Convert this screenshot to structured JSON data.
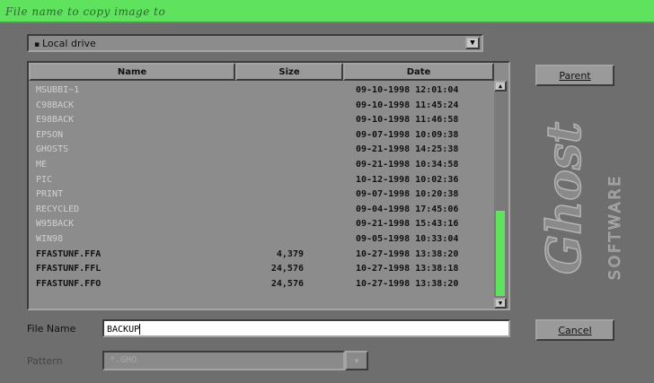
{
  "title": "File name to copy image to",
  "drive": {
    "label": "Local drive",
    "dropdown_icon": "triangle-down-icon"
  },
  "columns": [
    "Name",
    "Size",
    "Date"
  ],
  "files": [
    {
      "name": "MSUBBI~1",
      "size": "",
      "date": "09-10-1998 12:01:04",
      "kind": "dir"
    },
    {
      "name": "C98BACK",
      "size": "",
      "date": "09-10-1998 11:45:24",
      "kind": "dir"
    },
    {
      "name": "E98BACK",
      "size": "",
      "date": "09-10-1998 11:46:58",
      "kind": "dir"
    },
    {
      "name": "EPSON",
      "size": "",
      "date": "09-07-1998 10:09:38",
      "kind": "dir"
    },
    {
      "name": "GHOSTS",
      "size": "",
      "date": "09-21-1998 14:25:38",
      "kind": "dir"
    },
    {
      "name": "ME",
      "size": "",
      "date": "09-21-1998 10:34:58",
      "kind": "dir"
    },
    {
      "name": "PIC",
      "size": "",
      "date": "10-12-1998 10:02:36",
      "kind": "dir"
    },
    {
      "name": "PRINT",
      "size": "",
      "date": "09-07-1998 10:20:38",
      "kind": "dir"
    },
    {
      "name": "RECYCLED",
      "size": "",
      "date": "09-04-1998 17:45:06",
      "kind": "dir"
    },
    {
      "name": "W95BACK",
      "size": "",
      "date": "09-21-1998 15:43:16",
      "kind": "dir"
    },
    {
      "name": "WIN98",
      "size": "",
      "date": "09-05-1998 10:33:04",
      "kind": "dir"
    },
    {
      "name": "FFASTUNF.FFA",
      "size": "4,379",
      "date": "10-27-1998 13:38:20",
      "kind": "file"
    },
    {
      "name": "FFASTUNF.FFL",
      "size": "24,576",
      "date": "10-27-1998 13:38:18",
      "kind": "file"
    },
    {
      "name": "FFASTUNF.FFO",
      "size": "24,576",
      "date": "10-27-1998 13:38:20",
      "kind": "file"
    }
  ],
  "scrollbar": {
    "thumb_start": 0.58,
    "thumb_end": 1.0,
    "thumb_color": "#5fe35f"
  },
  "buttons": {
    "parent": "Parent",
    "cancel": "Cancel"
  },
  "logo": {
    "word1": "Ghost",
    "word2": "SOFTWARE"
  },
  "filename": {
    "label": "File Name",
    "value": "BACKUP"
  },
  "pattern": {
    "label": "Pattern",
    "value": "*.GHO"
  },
  "colors": {
    "titlebar": "#5fe35f",
    "panel": "#6e6e6e",
    "list_bg": "#8c8c8c"
  }
}
